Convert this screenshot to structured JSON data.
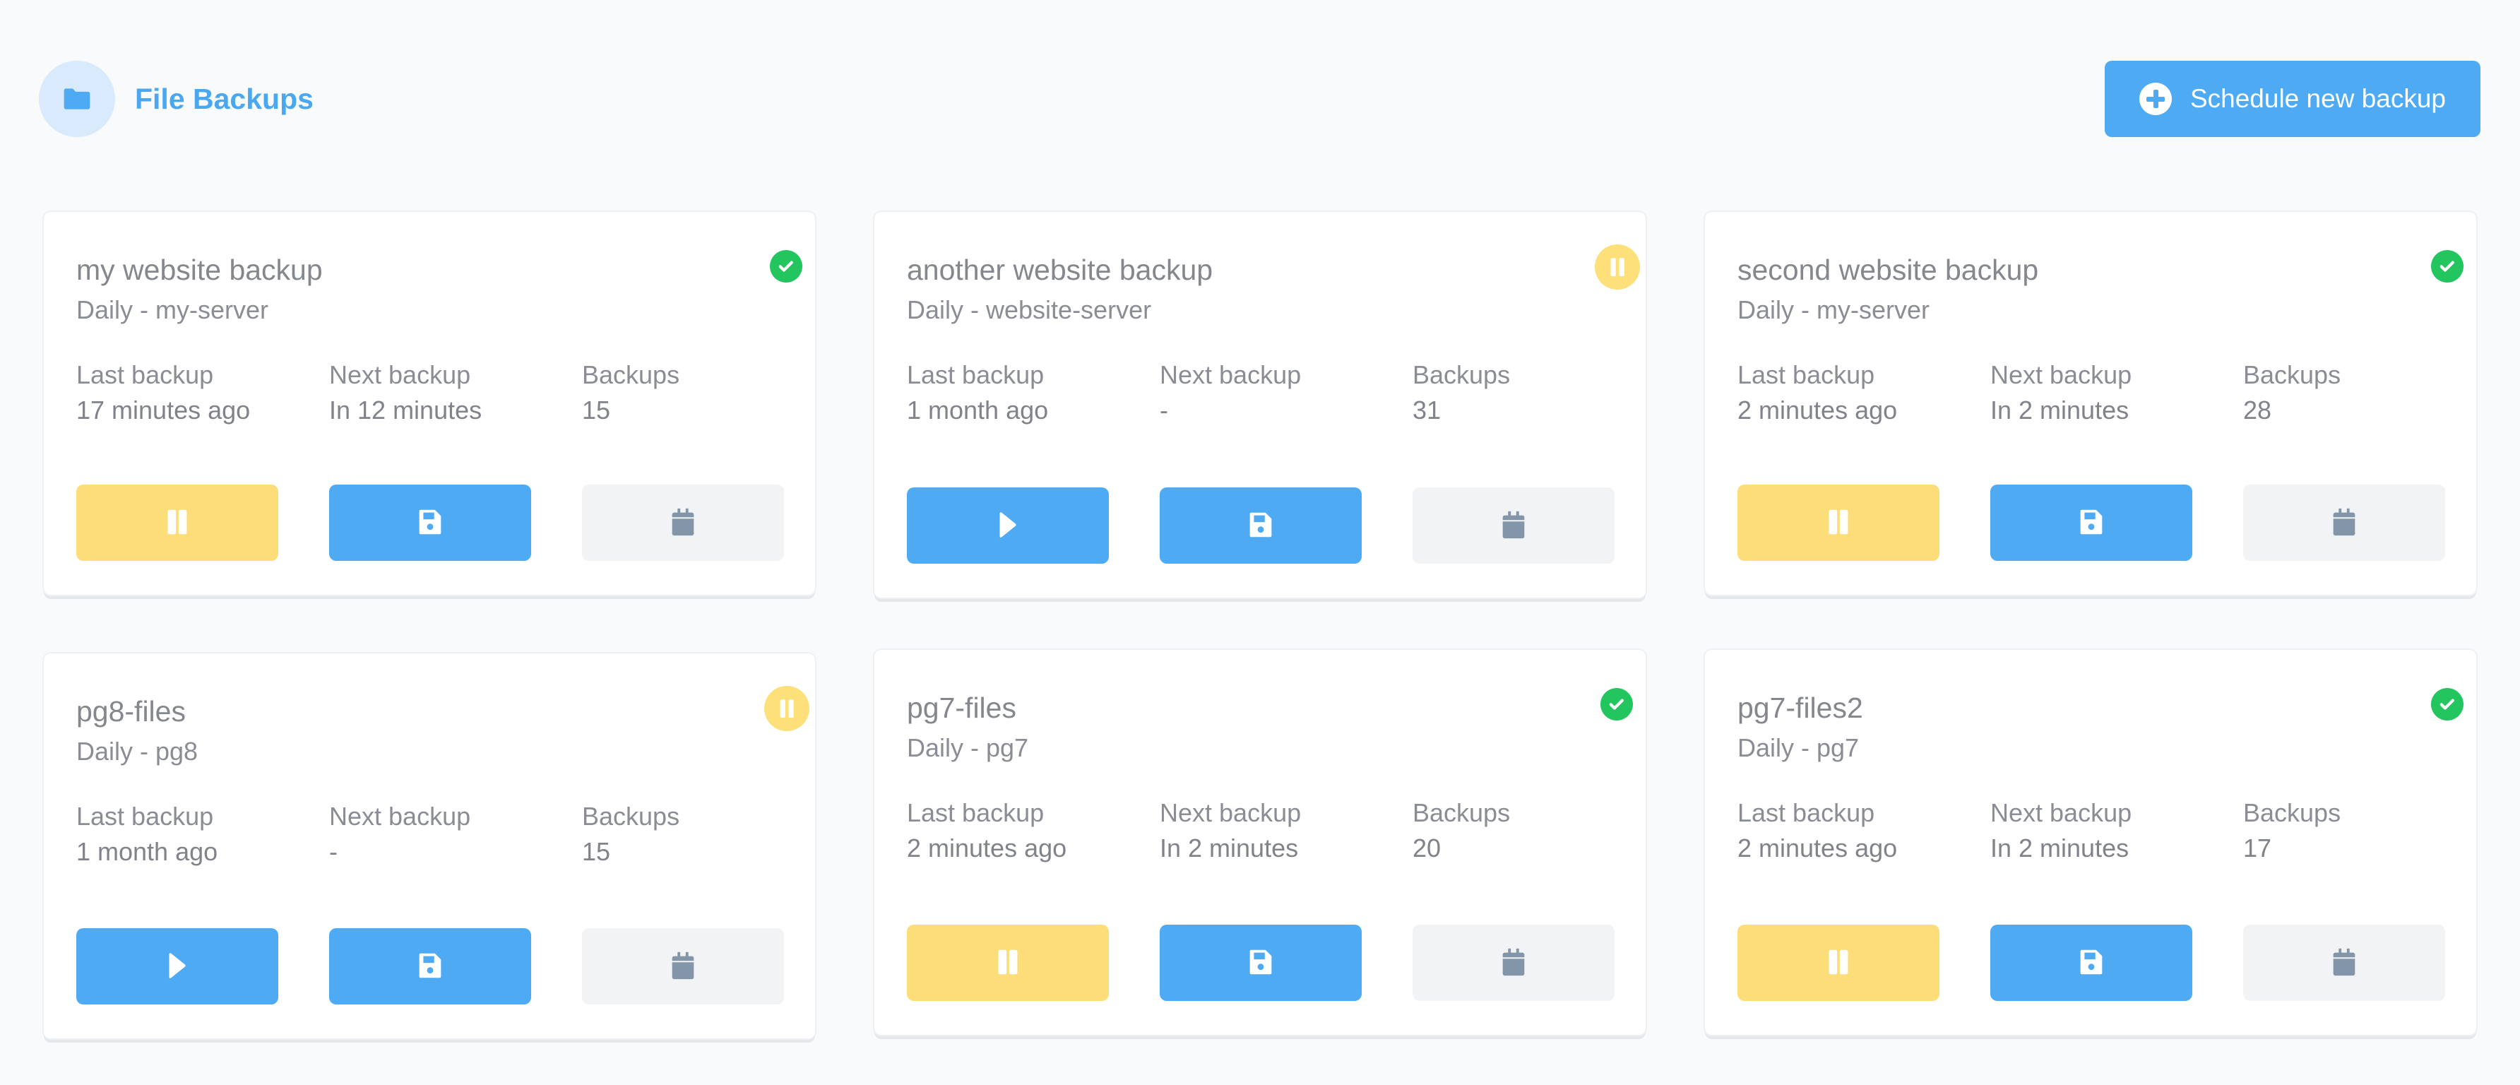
{
  "header": {
    "icon": "folder-icon",
    "title": "File Backups",
    "schedule_button": {
      "label": "Schedule new backup",
      "icon": "plus-circle-icon"
    }
  },
  "colors": {
    "accent": "#4eaaf3",
    "title": "#4aa8f0",
    "ok": "#22c55e",
    "paused": "#fde07a",
    "background": "#f8fafc",
    "secondary_button": "#f1f3f5",
    "calendar_icon": "#8395a8"
  },
  "labels": {
    "last_backup": "Last backup",
    "next_backup": "Next backup",
    "backups": "Backups"
  },
  "backups": [
    {
      "name": "my website backup",
      "schedule": "Daily - my-server",
      "status": "ok",
      "last_backup": "17 minutes ago",
      "next_backup": "In 12 minutes",
      "count": "15",
      "toggle_action": "pause"
    },
    {
      "name": "another website backup",
      "schedule": "Daily - website-server",
      "status": "paused",
      "last_backup": "1 month ago",
      "next_backup": "-",
      "count": "31",
      "toggle_action": "play"
    },
    {
      "name": "second website backup",
      "schedule": "Daily - my-server",
      "status": "ok",
      "last_backup": "2 minutes ago",
      "next_backup": "In 2 minutes",
      "count": "28",
      "toggle_action": "pause"
    },
    {
      "name": "pg8-files",
      "schedule": "Daily - pg8",
      "status": "paused",
      "last_backup": "1 month ago",
      "next_backup": "-",
      "count": "15",
      "toggle_action": "play"
    },
    {
      "name": "pg7-files",
      "schedule": "Daily - pg7",
      "status": "ok",
      "last_backup": "2 minutes ago",
      "next_backup": "In 2 minutes",
      "count": "20",
      "toggle_action": "pause"
    },
    {
      "name": "pg7-files2",
      "schedule": "Daily - pg7",
      "status": "ok",
      "last_backup": "2 minutes ago",
      "next_backup": "In 2 minutes",
      "count": "17",
      "toggle_action": "pause"
    }
  ]
}
